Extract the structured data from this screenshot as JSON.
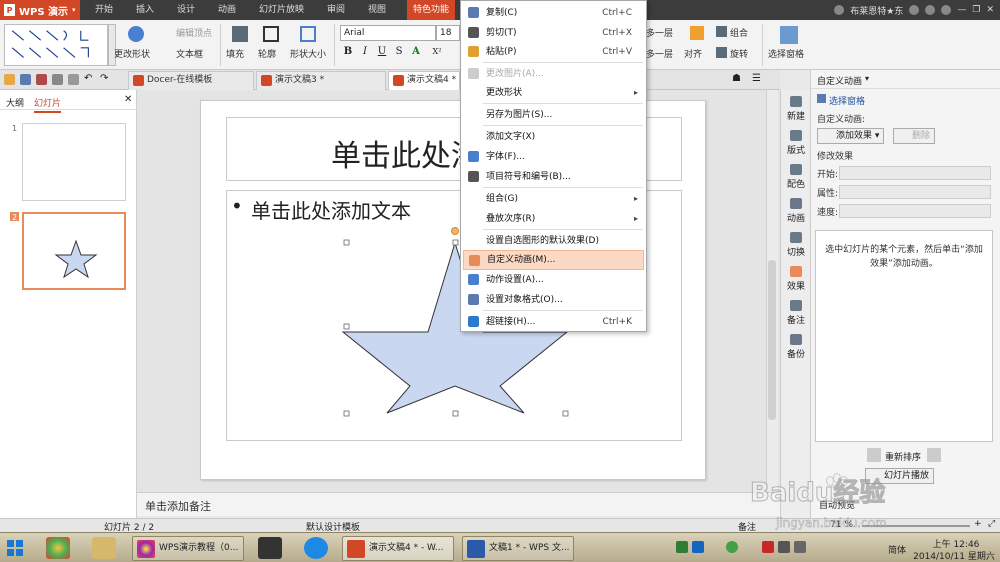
{
  "title_tabs": {
    "app_label": "WPS 演示",
    "tabs": [
      "开始",
      "插入",
      "设计",
      "动画",
      "幻灯片放映",
      "审阅",
      "视图",
      "特色功能"
    ],
    "user_name": "布莱恩特★东"
  },
  "ribbon": {
    "edit_vertex": "编辑顶点",
    "change_shape": "更改形状",
    "text_box": "文本框",
    "fill": "填充",
    "outline": "轮廓",
    "shape_size": "形状大小",
    "font_name": "Arial",
    "font_size": "18",
    "bold": "B",
    "italic": "I",
    "underline": "U",
    "strike": "S",
    "shadow": "X²",
    "font_color": "A",
    "up_layer": "多一层",
    "down_layer": "多一层",
    "align": "对齐",
    "group": "组合",
    "rotate": "旋转",
    "selection_pane": "选择窗格"
  },
  "doc_tabs": [
    "Docer-在线模板",
    "演示文稿3 *",
    "演示文稿4 *"
  ],
  "left_panel": {
    "tab_outline": "大纲",
    "tab_slides": "幻灯片",
    "slide_numbers": [
      "1",
      "2"
    ]
  },
  "slide": {
    "title_placeholder": "单击此处添",
    "body_placeholder": "单击此处添加文本",
    "bullet": "•"
  },
  "notes_placeholder": "单击添加备注",
  "sidebar": [
    "新建",
    "版式",
    "配色",
    "动画",
    "切换",
    "效果",
    "备注",
    "备份"
  ],
  "task_pane": {
    "title": "自定义动画",
    "select_pane": "选择窗格",
    "custom_animation_label": "自定义动画:",
    "add_effect": "添加效果",
    "delete": "删除",
    "modify_effect": "修改效果",
    "start_label": "开始:",
    "property_label": "属性:",
    "speed_label": "速度:",
    "hint": "选中幻灯片的某个元素，然后单击“添加效果”添加动画。",
    "reorder": "重新排序",
    "slideshow": "幻灯片播放",
    "auto_preview": "自动预览"
  },
  "context_menu": {
    "items": [
      {
        "label": "复制(C)",
        "shortcut": "Ctrl+C",
        "icon": "copy-icon"
      },
      {
        "label": "剪切(T)",
        "shortcut": "Ctrl+X",
        "icon": "cut-icon"
      },
      {
        "label": "粘贴(P)",
        "shortcut": "Ctrl+V",
        "icon": "paste-icon"
      },
      {
        "label": "更改图片(A)...",
        "disabled": true,
        "icon": "change-picture-icon"
      },
      {
        "label": "更改形状",
        "submenu": true
      },
      {
        "label": "另存为图片(S)..."
      },
      {
        "label": "添加文字(X)"
      },
      {
        "label": "字体(F)...",
        "icon": "font-icon"
      },
      {
        "label": "项目符号和编号(B)...",
        "icon": "bullets-icon"
      },
      {
        "label": "组合(G)",
        "submenu": true
      },
      {
        "label": "叠放次序(R)",
        "submenu": true
      },
      {
        "label": "设置自选图形的默认效果(D)"
      },
      {
        "label": "自定义动画(M)...",
        "highlighted": true,
        "icon": "custom-animation-icon"
      },
      {
        "label": "动作设置(A)...",
        "icon": "action-settings-icon"
      },
      {
        "label": "设置对象格式(O)...",
        "icon": "format-object-icon"
      },
      {
        "label": "超链接(H)...",
        "shortcut": "Ctrl+K",
        "icon": "hyperlink-icon"
      }
    ],
    "submenu_arrow": "▸"
  },
  "status_bar": {
    "slide_counter": "幻灯片 2 / 2",
    "template": "默认设计模板",
    "notes": "备注",
    "zoom": "71 %"
  },
  "taskbar": {
    "apps": [
      "WPS演示教程（0...",
      "演示文稿4 * - W...",
      "文稿1 * - WPS 文..."
    ],
    "ime": "简体",
    "time": "上午 12:46",
    "date": "2014/10/11 星期六"
  },
  "watermark": {
    "text": "Baidu经验",
    "url": "jingyan.baidu.com"
  },
  "colors": {
    "accent": "#d24726",
    "star_fill": "#c9d8f0",
    "highlight": "#fbd9c4",
    "slide_border": "#e88b5a"
  }
}
